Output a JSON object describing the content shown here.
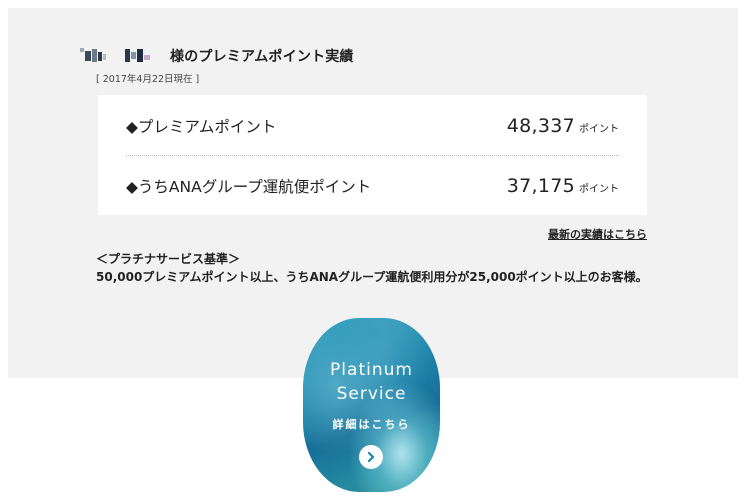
{
  "header": {
    "title": "様のプレミアムポイント実績",
    "date": "[ 2017年4月22日現在 ]"
  },
  "points": {
    "rows": [
      {
        "label": "◆プレミアムポイント",
        "value": "48,337",
        "unit": "ポイント"
      },
      {
        "label": "◆うちANAグループ運航便ポイント",
        "value": "37,175",
        "unit": "ポイント"
      }
    ]
  },
  "links": {
    "latest": "最新の実績はこちら"
  },
  "criteria": {
    "title": "＜プラチナサービス基準＞",
    "text": "50,000プレミアムポイント以上、うちANAグループ運航便利用分が25,000ポイント以上のお客様。"
  },
  "banner": {
    "line1": "Platinum",
    "line2": "Service",
    "sub": "詳細はこちら",
    "icon": "chevron-right-icon"
  },
  "colors": {
    "panel": "#f2f2f2",
    "card": "#ffffff",
    "banner_blue": "#1f86ab"
  }
}
